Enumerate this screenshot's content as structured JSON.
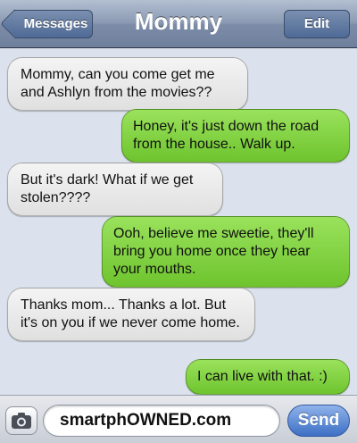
{
  "nav": {
    "back_label": "Messages",
    "title": "Mommy",
    "edit_label": "Edit"
  },
  "messages": [
    {
      "from": "them",
      "text": "Mommy, can you come get me and Ashlyn from the movies??"
    },
    {
      "from": "me",
      "text": "Honey, it's just down the road from the house.. Walk up."
    },
    {
      "from": "them",
      "text": "But it's dark! What if we get stolen????"
    },
    {
      "from": "me",
      "text": "Ooh, believe me sweetie, they'll bring you home once they hear your mouths."
    },
    {
      "from": "them",
      "text": "Thanks mom... Thanks a lot. But it's on you if we never come home."
    },
    {
      "from": "me",
      "text": "I can live with that. :)"
    }
  ],
  "composer": {
    "camera_icon": "camera-icon",
    "input_value": "smartphOWNED.com",
    "send_label": "Send"
  },
  "colors": {
    "incoming_bubble": "#e8e8e8",
    "outgoing_bubble": "#7ed03c",
    "background": "#dbe2ed",
    "navbar": "#8b9ab3",
    "send_button": "#3d6fc4"
  }
}
